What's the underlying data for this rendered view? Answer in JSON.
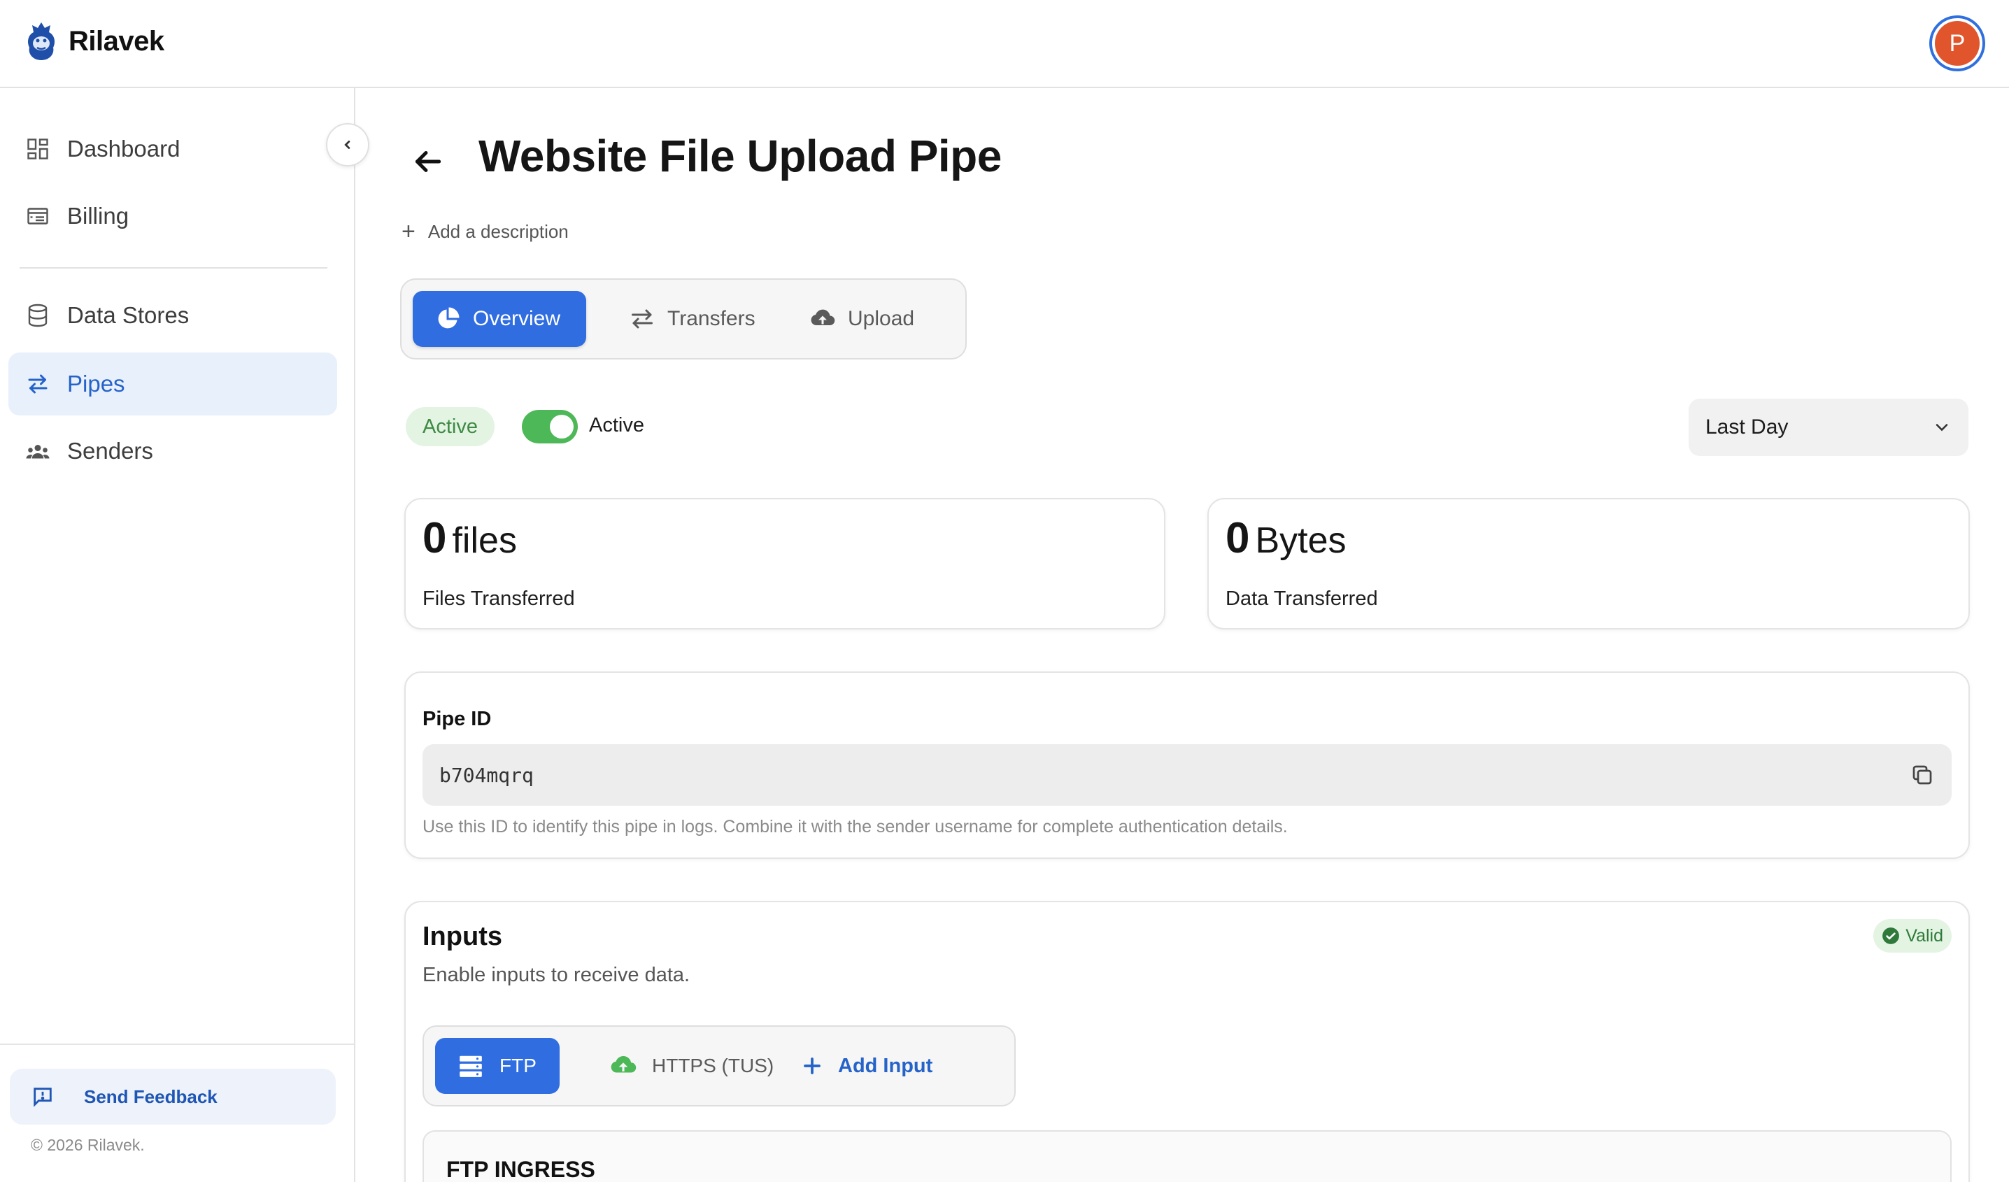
{
  "app": {
    "name": "Rilavek",
    "avatar_initial": "P"
  },
  "sidebar": {
    "items": [
      {
        "label": "Dashboard",
        "icon": "dashboard-icon",
        "active": false
      },
      {
        "label": "Billing",
        "icon": "billing-icon",
        "active": false
      },
      {
        "label": "Data Stores",
        "icon": "database-icon",
        "active": false
      },
      {
        "label": "Pipes",
        "icon": "pipes-icon",
        "active": true
      },
      {
        "label": "Senders",
        "icon": "senders-icon",
        "active": false
      }
    ],
    "feedback_label": "Send Feedback",
    "copyright": "© 2026 Rilavek."
  },
  "page": {
    "title": "Website File Upload Pipe",
    "add_description": "Add a description",
    "tabs": [
      {
        "label": "Overview",
        "icon": "pie-chart-icon",
        "active": true
      },
      {
        "label": "Transfers",
        "icon": "transfer-icon",
        "active": false
      },
      {
        "label": "Upload",
        "icon": "cloud-upload-icon",
        "active": false
      }
    ],
    "status_badge": "Active",
    "toggle_label": "Active",
    "toggle_on": true,
    "period": "Last Day"
  },
  "stats": {
    "files": {
      "value": "0",
      "unit": "files",
      "label": "Files Transferred"
    },
    "bytes": {
      "value": "0",
      "unit": "Bytes",
      "label": "Data Transferred"
    }
  },
  "pipe_id": {
    "title": "Pipe ID",
    "value": "b704mqrq",
    "help": "Use this ID to identify this pipe in logs. Combine it with the sender username for complete authentication details."
  },
  "inputs": {
    "title": "Inputs",
    "subtitle": "Enable inputs to receive data.",
    "valid_label": "Valid",
    "tabs": [
      {
        "label": "FTP",
        "icon": "server-icon",
        "active": true
      },
      {
        "label": "HTTPS (TUS)",
        "icon": "cloud-upload-icon",
        "active": false
      }
    ],
    "add_label": "Add Input",
    "section_title": "FTP INGRESS"
  },
  "colors": {
    "primary": "#2f6de0",
    "active_nav_bg": "#e8f0fc",
    "success": "#4cb857",
    "avatar": "#e0552c"
  }
}
